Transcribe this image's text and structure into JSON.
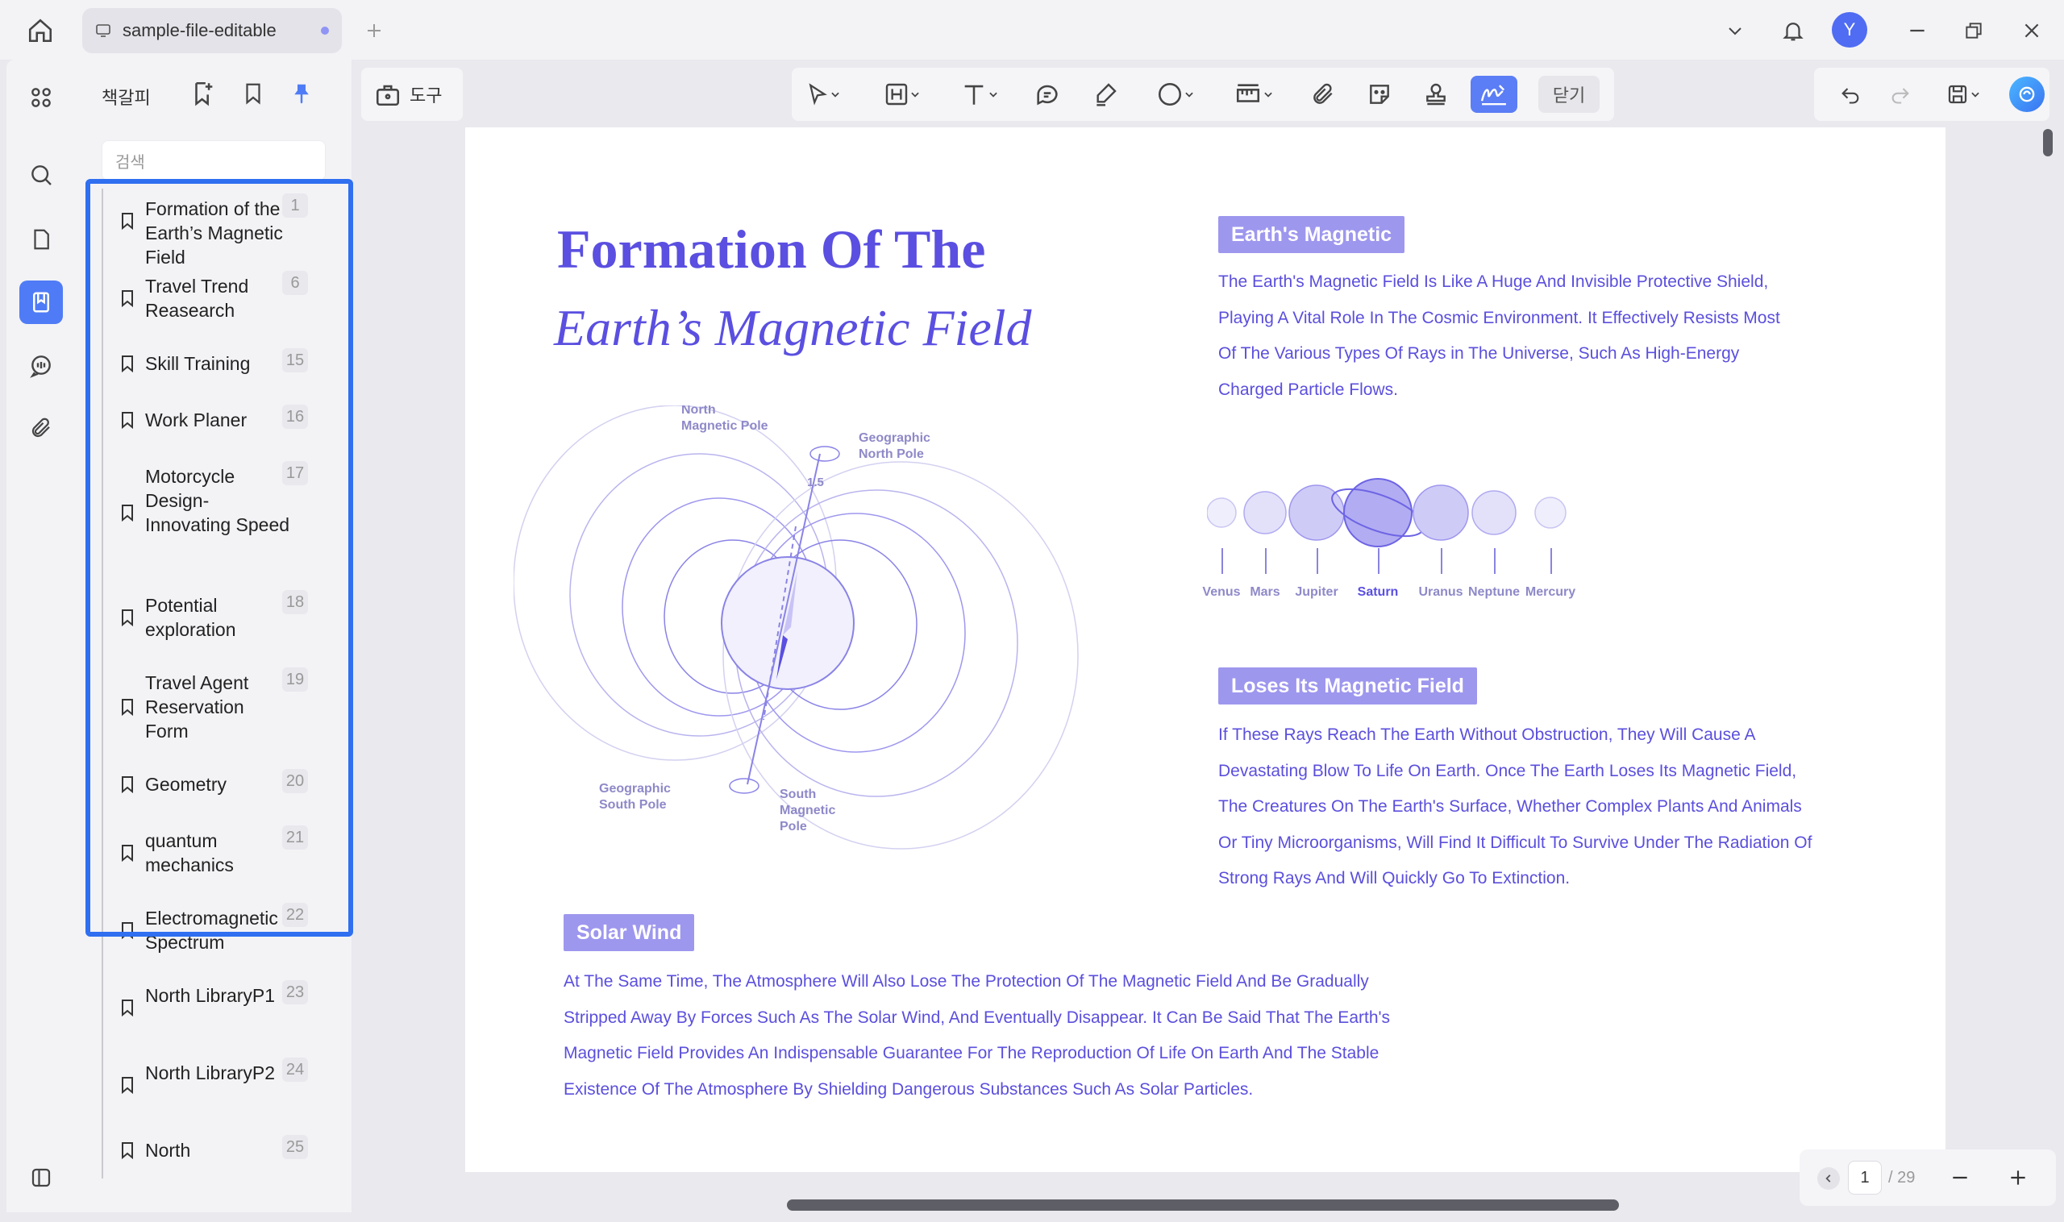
{
  "tab": {
    "title": "sample-file-editable"
  },
  "avatar": {
    "initial": "Y"
  },
  "panel": {
    "title": "책갈피",
    "search_placeholder": "검색",
    "bookmarks": [
      {
        "label": "Formation of the Earth’s Magnetic Field",
        "page": "1"
      },
      {
        "label": "Travel Trend Reasearch",
        "page": "6"
      },
      {
        "label": "Skill Training",
        "page": "15"
      },
      {
        "label": "Work Planer",
        "page": "16"
      },
      {
        "label": "Motorcycle Design-Innovating Speed",
        "page": "17"
      },
      {
        "label": "Potential exploration",
        "page": "18"
      },
      {
        "label": "Travel Agent Reservation Form",
        "page": "19"
      },
      {
        "label": "Geometry",
        "page": "20"
      },
      {
        "label": "quantum mechanics",
        "page": "21"
      },
      {
        "label": "Electromagnetic Spectrum",
        "page": "22"
      },
      {
        "label": "North LibraryP1",
        "page": "23"
      },
      {
        "label": "North LibraryP2",
        "page": "24"
      },
      {
        "label": "North",
        "page": "25"
      }
    ]
  },
  "toolbar": {
    "tools_label": "도구",
    "close_label": "닫기"
  },
  "document": {
    "title_line1": "Formation Of The",
    "title_line2": "Earth’s Magnetic Field",
    "diagram_labels": {
      "north_magnetic_pole": "North Magnetic Pole",
      "geographic_north_pole": "Geographic North Pole",
      "geographic_south_pole": "Geographic South Pole",
      "south_magnetic_pole": "South Magnetic Pole",
      "angle": "1.5"
    },
    "section1": {
      "heading": "Earth's Magnetic",
      "body": "The Earth's Magnetic Field Is Like A Huge And Invisible Protective Shield, Playing A Vital Role In The Cosmic Environment. It Effectively Resists Most Of The Various Types Of Rays in The Universe, Such As High-Energy Charged Particle Flows."
    },
    "planets": [
      "Venus",
      "Mars",
      "Jupiter",
      "Saturn",
      "Uranus",
      "Neptune",
      "Mercury"
    ],
    "section2": {
      "heading": "Loses Its Magnetic Field",
      "body": "If These Rays Reach The Earth Without Obstruction, They Will Cause A Devastating Blow To Life On Earth. Once The Earth Loses Its Magnetic Field, The Creatures On The Earth's Surface, Whether Complex Plants And Animals Or Tiny Microorganisms, Will Find It Difficult To Survive Under The Radiation Of Strong Rays And Will Quickly Go To Extinction."
    },
    "section3": {
      "heading": "Solar Wind",
      "body": "At The Same Time, The Atmosphere Will Also Lose The Protection Of The Magnetic Field And Be Gradually Stripped Away By Forces Such As The Solar Wind, And Eventually Disappear. It Can Be Said That The Earth's Magnetic Field Provides An Indispensable Guarantee For The Reproduction Of Life On Earth And The Stable Existence Of The Atmosphere By Shielding Dangerous Substances Such As Solar Particles."
    }
  },
  "pagenav": {
    "current": "1",
    "total": "/ 29"
  },
  "colors": {
    "accent": "#4f7cf6",
    "doc_text": "#5b4fdc",
    "highlight": "#2f6ff0",
    "pill": "#9e97ee"
  }
}
